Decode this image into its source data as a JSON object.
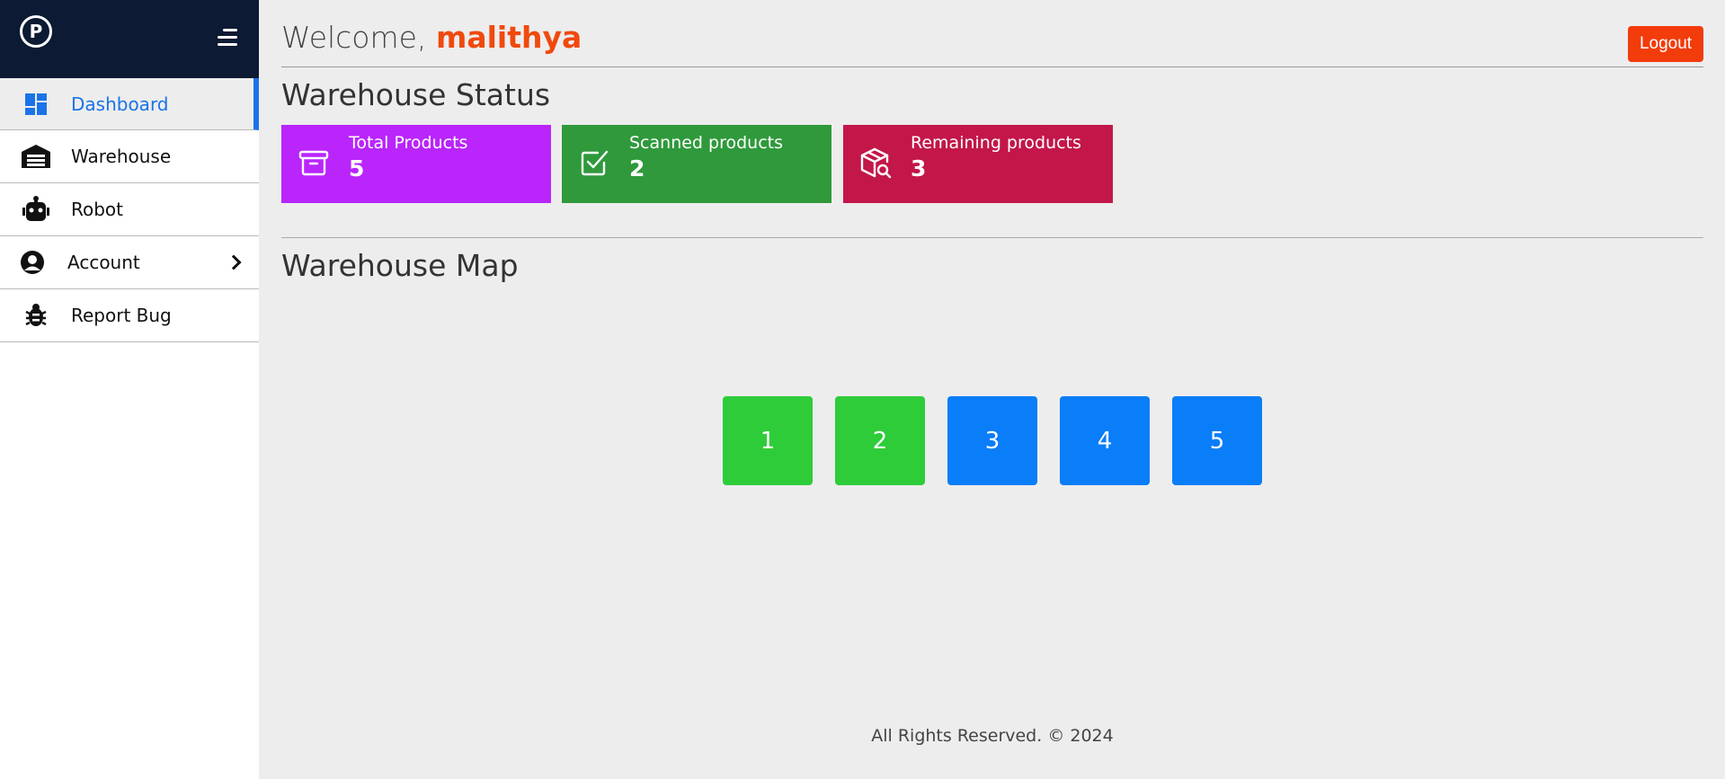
{
  "sidebar": {
    "logo_letter": "P",
    "items": [
      {
        "label": "Dashboard"
      },
      {
        "label": "Warehouse"
      },
      {
        "label": "Robot"
      },
      {
        "label": "Account"
      },
      {
        "label": "Report Bug"
      }
    ]
  },
  "header": {
    "welcome_prefix": "Welcome, ",
    "username": "malithya",
    "logout_label": "Logout"
  },
  "status": {
    "title": "Warehouse Status",
    "cards": [
      {
        "label": "Total Products",
        "value": "5",
        "color": "#b925fb",
        "icon": "archive-icon"
      },
      {
        "label": "Scanned products",
        "value": "2",
        "color": "#2f993c",
        "icon": "checkbox-icon"
      },
      {
        "label": "Remaining products",
        "value": "3",
        "color": "#c31649",
        "icon": "package-search-icon"
      }
    ]
  },
  "map": {
    "title": "Warehouse Map",
    "slots": [
      {
        "label": "1",
        "status": "scanned",
        "color": "#2ecc39"
      },
      {
        "label": "2",
        "status": "scanned",
        "color": "#2ecc39"
      },
      {
        "label": "3",
        "status": "remaining",
        "color": "#0a7df8"
      },
      {
        "label": "4",
        "status": "remaining",
        "color": "#0a7df8"
      },
      {
        "label": "5",
        "status": "remaining",
        "color": "#0a7df8"
      }
    ]
  },
  "footer": {
    "text": "All Rights Reserved. © 2024"
  },
  "colors": {
    "accent": "#1a73e8",
    "brand": "#0c1a33",
    "logout": "#f23c0b"
  }
}
